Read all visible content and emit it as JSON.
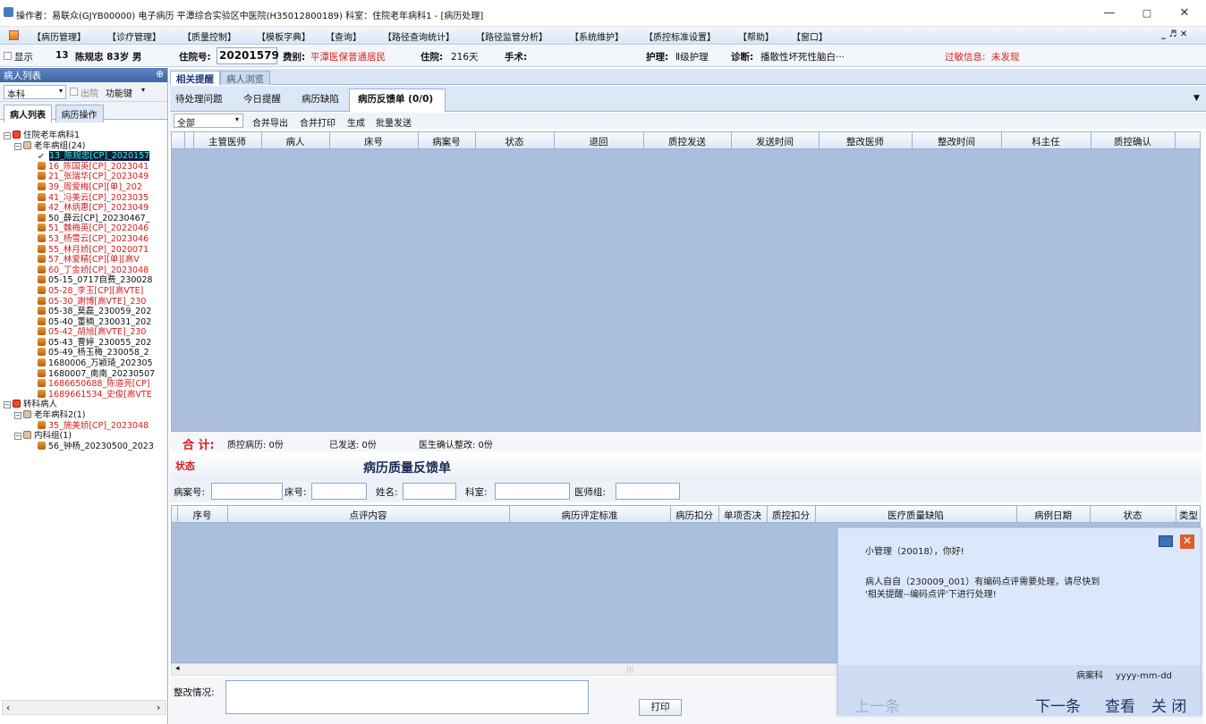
{
  "window": {
    "title": "操作者：易联众(GJYB00000) 电子病历  平潭综合实验区中医院(H35012800189)  科室：住院老年病科1 - [病历处理]",
    "min": "—",
    "max": "▢",
    "close": "✕"
  },
  "menu": [
    "【病历管理】",
    "【诊疗管理】",
    "【质量控制】",
    "【模板字典】",
    "【查询】",
    "【路径查询统计】",
    "【路径监管分析】",
    "【系统维护】",
    "【质控标准设置】",
    "【帮助】",
    "【窗口】"
  ],
  "menu_right": "_ ♬ ✕",
  "info": {
    "show_label": "显示",
    "bed": "13",
    "patient": "陈规忠 83岁 男",
    "admission_label": "住院号:",
    "admission_no": "20201579",
    "type_label": "费别:",
    "type_value": "平潭医保普通居民",
    "stay_label": "住院:",
    "stay_value": "216天",
    "surgery_label": "手术:",
    "nursing_label": "护理:",
    "nursing_value": "Ⅱ级护理",
    "diag_label": "诊断:",
    "diag_value": "播散性坏死性脑白···",
    "allergy_label": "过敏信息:",
    "allergy_value": "未发现"
  },
  "left": {
    "panel_title": "病人列表",
    "pin": "⊕",
    "dept": "本科",
    "discharged": "出院",
    "funcs": "功能键",
    "tab_patients": "病人列表",
    "tab_ops": "病历操作",
    "tree": [
      {
        "t": "住院老年病科1",
        "lvl": 0,
        "ico": "dep",
        "exp": "−"
      },
      {
        "t": "老年病组(24)",
        "lvl": 1,
        "ico": "grp",
        "exp": "−"
      },
      {
        "t": "13_陈规忠[CP]_2020157",
        "lvl": 2,
        "ico": "chk",
        "sel": true
      },
      {
        "t": "16_陈国英[CP]_2023041",
        "lvl": 2,
        "ico": "pat",
        "red": true
      },
      {
        "t": "21_张瑞华[CP]_2023049",
        "lvl": 2,
        "ico": "pat",
        "red": true
      },
      {
        "t": "39_周爱梅[CP][单]_202",
        "lvl": 2,
        "ico": "pat",
        "red": true
      },
      {
        "t": "41_冯美云[CP]_2023035",
        "lvl": 2,
        "ico": "pat",
        "red": true
      },
      {
        "t": "42_林炳惠[CP]_2023049",
        "lvl": 2,
        "ico": "pat",
        "red": true
      },
      {
        "t": "50_薛云[CP]_20230467_",
        "lvl": 2,
        "ico": "pat"
      },
      {
        "t": "51_魏梅英[CP]_2022046",
        "lvl": 2,
        "ico": "pat",
        "red": true
      },
      {
        "t": "53_杨雪云[CP]_2023046",
        "lvl": 2,
        "ico": "pat",
        "red": true
      },
      {
        "t": "55_林月娇[CP]_2020071",
        "lvl": 2,
        "ico": "pat",
        "red": true
      },
      {
        "t": "57_林爱精[CP][单][高V",
        "lvl": 2,
        "ico": "pat",
        "red": true
      },
      {
        "t": "60_丁金娇[CP]_2023048",
        "lvl": 2,
        "ico": "pat",
        "red": true
      },
      {
        "t": "05-15_0717自费_230028",
        "lvl": 2,
        "ico": "pat"
      },
      {
        "t": "05-28_李玉[CP][高VTE]",
        "lvl": 2,
        "ico": "pat",
        "red": true
      },
      {
        "t": "05-30_謝博[高VTE]_230",
        "lvl": 2,
        "ico": "pat",
        "red": true
      },
      {
        "t": "05-38_莫磊_230059_202",
        "lvl": 2,
        "ico": "pat"
      },
      {
        "t": "05-40_董楠_230031_202",
        "lvl": 2,
        "ico": "pat"
      },
      {
        "t": "05-42_胡旭[高VTE]_230",
        "lvl": 2,
        "ico": "pat",
        "red": true
      },
      {
        "t": "05-43_曹婷_230055_202",
        "lvl": 2,
        "ico": "pat"
      },
      {
        "t": "05-49_杨玉梅_230058_2",
        "lvl": 2,
        "ico": "pat"
      },
      {
        "t": "1680006_万颖琦_202305",
        "lvl": 2,
        "ico": "pat"
      },
      {
        "t": "1680007_南南_20230507",
        "lvl": 2,
        "ico": "pat"
      },
      {
        "t": "1686650688_陈道亮[CP]",
        "lvl": 2,
        "ico": "pat",
        "red": true
      },
      {
        "t": "1689661534_史俊[高VTE",
        "lvl": 2,
        "ico": "pat",
        "red": true
      },
      {
        "t": "转科病人",
        "lvl": 0,
        "ico": "dep",
        "exp": "−"
      },
      {
        "t": "老年病科2(1)",
        "lvl": 1,
        "ico": "grp",
        "exp": "−"
      },
      {
        "t": "35_施美娇[CP]_2023048",
        "lvl": 2,
        "ico": "pat",
        "red": true
      },
      {
        "t": "内科组(1)",
        "lvl": 1,
        "ico": "grp",
        "exp": "−"
      },
      {
        "t": "56_钟杨_20230500_2023",
        "lvl": 2,
        "ico": "pat"
      }
    ],
    "scroll_left": "‹",
    "scroll_right": "›"
  },
  "main": {
    "tab_related": "相关提醒",
    "tab_browse": "病人浏览",
    "subtabs": [
      "待处理问题",
      "今日提醒",
      "病历缺陷",
      "病历反馈单 (0/0)"
    ],
    "filter_all": "全部",
    "actions": [
      "合并导出",
      "合并打印",
      "生成",
      "批量发送"
    ],
    "grid1_cols": [
      "主管医师",
      "病人",
      "床号",
      "病案号",
      "状态",
      "退回",
      "质控发送",
      "发送时间",
      "整改医师",
      "整改时间",
      "科主任",
      "质控确认"
    ],
    "sum_label": "合 计:",
    "sum_items": [
      "质控病历: 0份",
      "已发送: 0份",
      "医生确认整改: 0份"
    ],
    "fb_state": "状态",
    "fb_title": "病历质量反馈单",
    "filters": [
      "病案号:",
      "床号:",
      "姓名:",
      "科室:",
      "医师组:"
    ],
    "grid2_cols": [
      "序号",
      "点评内容",
      "病历评定标准",
      "病历扣分",
      "单项否决",
      "质控扣分",
      "医疗质量缺陷",
      "病例日期",
      "状态",
      "类型"
    ],
    "rectify_label": "整改情况:",
    "print": "打印"
  },
  "popup": {
    "greet": "小管理（20018），你好!",
    "msg1": "病人自自（230009_001）有编码点评需要处理，请尽快到",
    "msg2": "'相关提醒--编码点评'下进行处理!",
    "dept": "病案科",
    "date": "yyyy-mm-dd",
    "prev": "上一条",
    "next": "下一条",
    "view": "查看",
    "close": "关 闭"
  }
}
